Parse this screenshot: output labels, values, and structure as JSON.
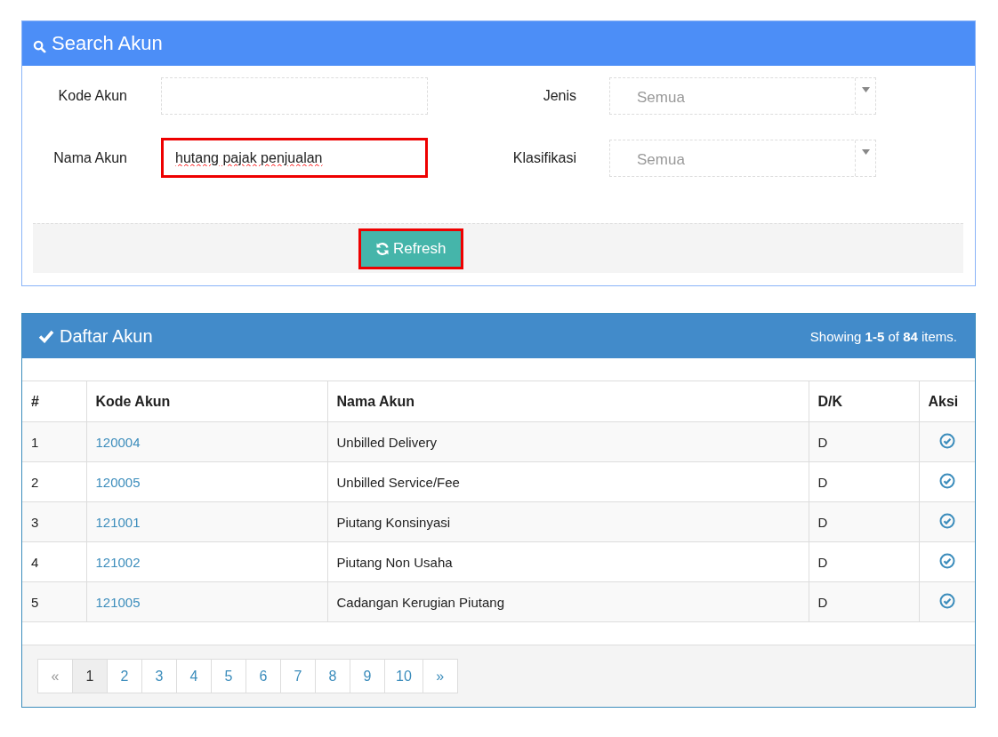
{
  "search_panel": {
    "title": "Search Akun",
    "fields": [
      {
        "kind": "input",
        "label": "Kode Akun",
        "highlighted": false
      },
      {
        "kind": "select",
        "label": "Jenis",
        "placeholder": "Semua",
        "highlighted": false
      },
      {
        "kind": "input",
        "label": "Nama Akun",
        "value": "hutang pajak penjualan",
        "highlighted": true
      },
      {
        "kind": "select",
        "label": "Klasifikasi",
        "placeholder": "Semua",
        "highlighted": false
      }
    ],
    "refresh_button": {
      "label": "Refresh",
      "highlighted": true
    }
  },
  "list_panel": {
    "title": "Daftar Akun",
    "summary": "Showing **1-5** of **84** items.",
    "table": {
      "columns": [
        "#",
        "Kode Akun",
        "Nama Akun",
        "D/K",
        "Aksi"
      ],
      "rows": [
        {
          "no": "1",
          "kode": "120004",
          "nama": "Unbilled Delivery",
          "dk": "D"
        },
        {
          "no": "2",
          "kode": "120005",
          "nama": "Unbilled Service/Fee",
          "dk": "D"
        },
        {
          "no": "3",
          "kode": "121001",
          "nama": "Piutang Konsinyasi",
          "dk": "D"
        },
        {
          "no": "4",
          "kode": "121002",
          "nama": "Piutang Non Usaha",
          "dk": "D"
        },
        {
          "no": "5",
          "kode": "121005",
          "nama": "Cadangan Kerugian Piutang",
          "dk": "D"
        }
      ]
    },
    "pagination": [
      {
        "label": "«",
        "selected": false,
        "disabled": true
      },
      {
        "label": "1",
        "selected": true,
        "disabled": false
      },
      {
        "label": "2",
        "selected": false,
        "disabled": false
      },
      {
        "label": "3",
        "selected": false,
        "disabled": false
      },
      {
        "label": "4",
        "selected": false,
        "disabled": false
      },
      {
        "label": "5",
        "selected": false,
        "disabled": false
      },
      {
        "label": "6",
        "selected": false,
        "disabled": false
      },
      {
        "label": "7",
        "selected": false,
        "disabled": false
      },
      {
        "label": "8",
        "selected": false,
        "disabled": false
      },
      {
        "label": "9",
        "selected": false,
        "disabled": false
      },
      {
        "label": "10",
        "selected": false,
        "disabled": false
      },
      {
        "label": "»",
        "selected": false,
        "disabled": false
      }
    ]
  }
}
